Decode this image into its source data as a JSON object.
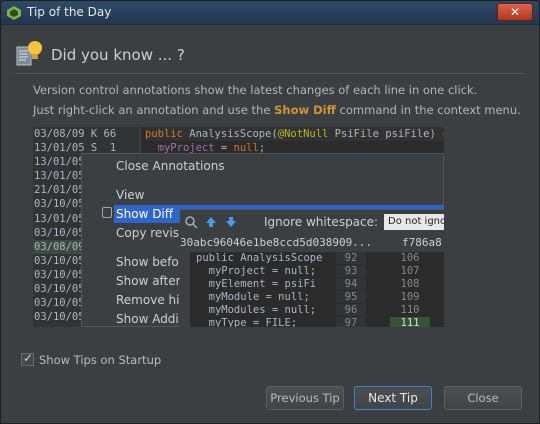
{
  "window": {
    "title": "Tip of the Day",
    "close_glyph": "✕"
  },
  "header": {
    "title": "Did you know ... ?"
  },
  "tip": {
    "line1": "Version control annotations show the latest changes of each line in one click.",
    "line2_pre": "Just right-click an annotation and use the ",
    "line2_highlight": "Show Diff",
    "line2_post": " command in the context menu."
  },
  "screenshot": {
    "annotations": [
      "03/08/09 K 66",
      "13/01/05 S  1",
      "13/01/05 S",
      "13/01/05 S",
      "21/01/05 K",
      "03/10/05 J",
      "13/01/05 S",
      "03/10/05 J",
      "03/08/09 K",
      "03/10/05 J",
      "03/10/05 J",
      "03/10/05 J",
      "03/10/05 J",
      "03/10/05 J"
    ],
    "code_line1": "public AnalysisScope(@NotNull PsiFile psiFile) {",
    "code_line2": "myProject = null;",
    "context_menu": {
      "items": [
        "Close Annotations",
        "View",
        "Show Diff",
        "Copy revis",
        "Show befo",
        "Show after",
        "Remove hi",
        "Show Addi"
      ]
    },
    "diff_popup": {
      "ignore_label": "Ignore whitespace:",
      "ignore_value": "Do not igno",
      "hash_left": "30abc96046e1be8ccd5d038909...",
      "hash_right": "f786a8",
      "lines": [
        {
          "code": "public AnalysisScope",
          "left": "92",
          "right": "106"
        },
        {
          "code": "  myProject = null;",
          "left": "93",
          "right": "107"
        },
        {
          "code": "  myElement = psiFi",
          "left": "94",
          "right": "108"
        },
        {
          "code": "  myModule = null;",
          "left": "95",
          "right": "109"
        },
        {
          "code": "  myModules = null;",
          "left": "96",
          "right": "110"
        },
        {
          "code": "  myType = FILE;",
          "left": "97",
          "right": "111"
        }
      ]
    }
  },
  "footer": {
    "show_tips_label": "Show Tips on Startup",
    "show_tips_checked": true,
    "prev_label": "Previous Tip",
    "next_label": "Next Tip",
    "close_label": "Close"
  },
  "colors": {
    "accent_blue": "#2f65ca",
    "highlight_orange": "#d0953a",
    "background": "#3c3f41"
  }
}
